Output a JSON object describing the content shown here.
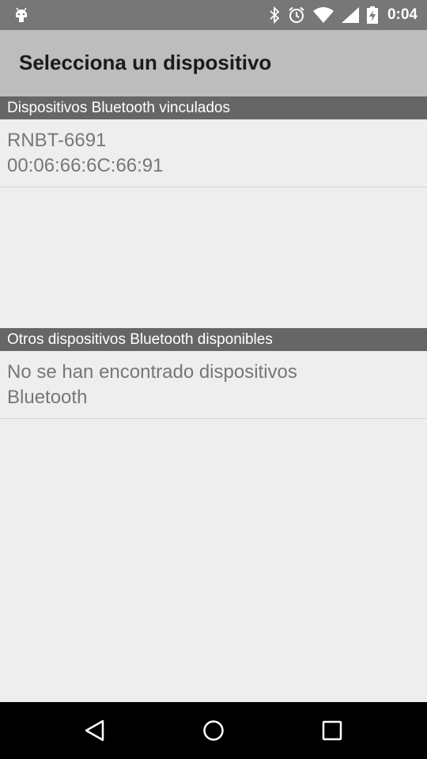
{
  "status_bar": {
    "notification_icon": "android-debug-icon",
    "icons": [
      "bluetooth-icon",
      "alarm-icon",
      "wifi-icon",
      "signal-icon",
      "battery-charging-icon"
    ],
    "time": "0:04"
  },
  "header": {
    "title": "Selecciona un dispositivo"
  },
  "paired_section": {
    "title": "Dispositivos Bluetooth vinculados",
    "devices": [
      {
        "name": "RNBT-6691",
        "address": "00:06:66:6C:66:91"
      }
    ]
  },
  "available_section": {
    "title": "Otros dispositivos Bluetooth disponibles",
    "empty_message_line1": "No se han encontrado dispositivos",
    "empty_message_line2": "Bluetooth"
  },
  "nav_bar": {
    "buttons": [
      "back-icon",
      "home-icon",
      "recents-icon"
    ]
  },
  "colors": {
    "status_bar": "#777777",
    "title_bar": "#bdbdbd",
    "section_header": "#666666",
    "background": "#eeeeee",
    "nav_bar": "#000000"
  }
}
